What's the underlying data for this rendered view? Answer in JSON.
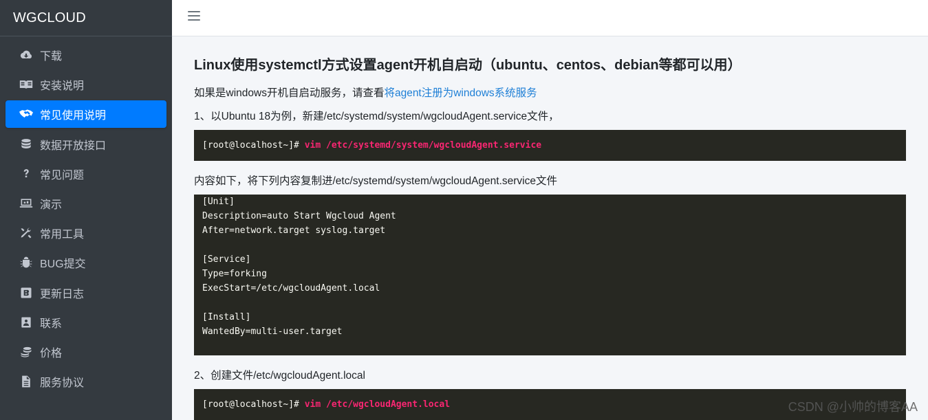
{
  "brand": {
    "title": "WGCLOUD"
  },
  "sidebar": {
    "items": [
      {
        "label": "下载",
        "icon": "cloud-download-icon"
      },
      {
        "label": "安装说明",
        "icon": "book-icon"
      },
      {
        "label": "常见使用说明",
        "icon": "handshake-icon",
        "active": true
      },
      {
        "label": "数据开放接口",
        "icon": "database-icon"
      },
      {
        "label": "常见问题",
        "icon": "question-icon"
      },
      {
        "label": "演示",
        "icon": "laptop-icon"
      },
      {
        "label": "常用工具",
        "icon": "tools-icon"
      },
      {
        "label": "BUG提交",
        "icon": "bug-icon"
      },
      {
        "label": "更新日志",
        "icon": "blog-icon"
      },
      {
        "label": "联系",
        "icon": "contact-icon"
      },
      {
        "label": "价格",
        "icon": "coins-icon"
      },
      {
        "label": "服务协议",
        "icon": "file-icon"
      }
    ]
  },
  "topbar": {
    "menu_icon": "hamburger-menu-icon"
  },
  "main": {
    "title": "Linux使用systemctl方式设置agent开机自启动（ubuntu、centos、debian等都可以用）",
    "intro_text": "如果是windows开机自启动服务，请查看",
    "intro_link": "将agent注册为windows系统服务",
    "step1": "1、以Ubuntu 18为例，新建/etc/systemd/system/wgcloudAgent.service文件，",
    "cmd1_prompt": "[root@localhost~]# ",
    "cmd1_text": "vim /etc/systemd/system/wgcloudAgent.service",
    "mid_text": "内容如下，将下列内容复制进/etc/systemd/system/wgcloudAgent.service文件",
    "service_file": "[Unit]\nDescription=auto Start Wgcloud Agent\nAfter=network.target syslog.target\n\n[Service]\nType=forking\nExecStart=/etc/wgcloudAgent.local\n\n[Install]\nWantedBy=multi-user.target",
    "step2": "2、创建文件/etc/wgcloudAgent.local",
    "cmd2_prompt": "[root@localhost~]# ",
    "cmd2_text": "vim /etc/wgcloudAgent.local"
  },
  "watermark": "CSDN @小帅的博客AA",
  "colors": {
    "sidebar_bg": "#343a40",
    "active_item": "#007bff",
    "code_bg": "#272822",
    "code_green": "#a6e22e",
    "code_command": "#f92672",
    "link": "#1e7fd6"
  }
}
